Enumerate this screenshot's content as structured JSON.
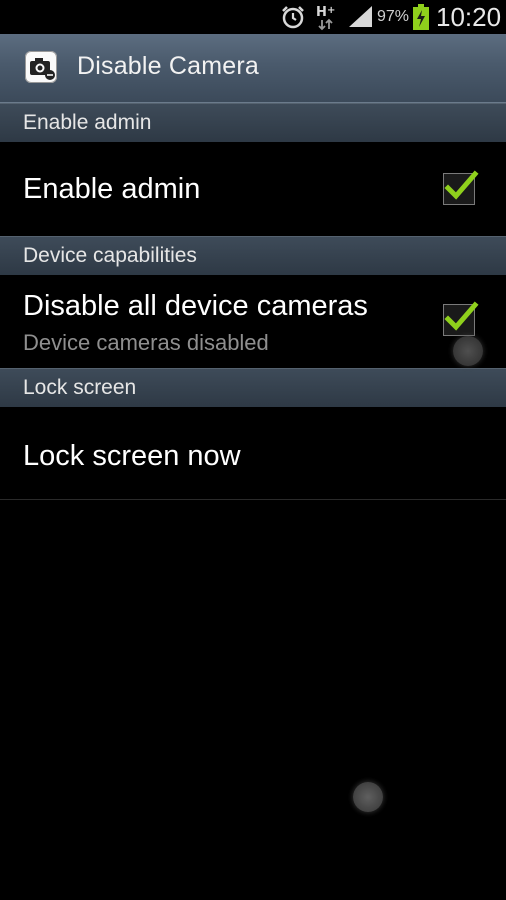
{
  "status_bar": {
    "icons": [
      "alarm-icon",
      "h-plus-data-icon",
      "signal-icon",
      "battery-charging-icon"
    ],
    "battery_percent": "97%",
    "time": "10:20",
    "battery_color": "#8fd01c"
  },
  "action_bar": {
    "title": "Disable Camera",
    "icon": "camera-icon"
  },
  "sections": [
    {
      "header": "Enable admin",
      "items": [
        {
          "title": "Enable admin",
          "summary": "",
          "checked": true
        }
      ]
    },
    {
      "header": "Device capabilities",
      "items": [
        {
          "title": "Disable all device cameras",
          "summary": "Device cameras disabled",
          "checked": true
        }
      ]
    },
    {
      "header": "Lock screen",
      "items": [
        {
          "title": "Lock screen now",
          "summary": ""
        }
      ]
    }
  ],
  "colors": {
    "check_green": "#8fd01c",
    "action_bar": "#4a5a6c",
    "category_header": "#36434f"
  }
}
